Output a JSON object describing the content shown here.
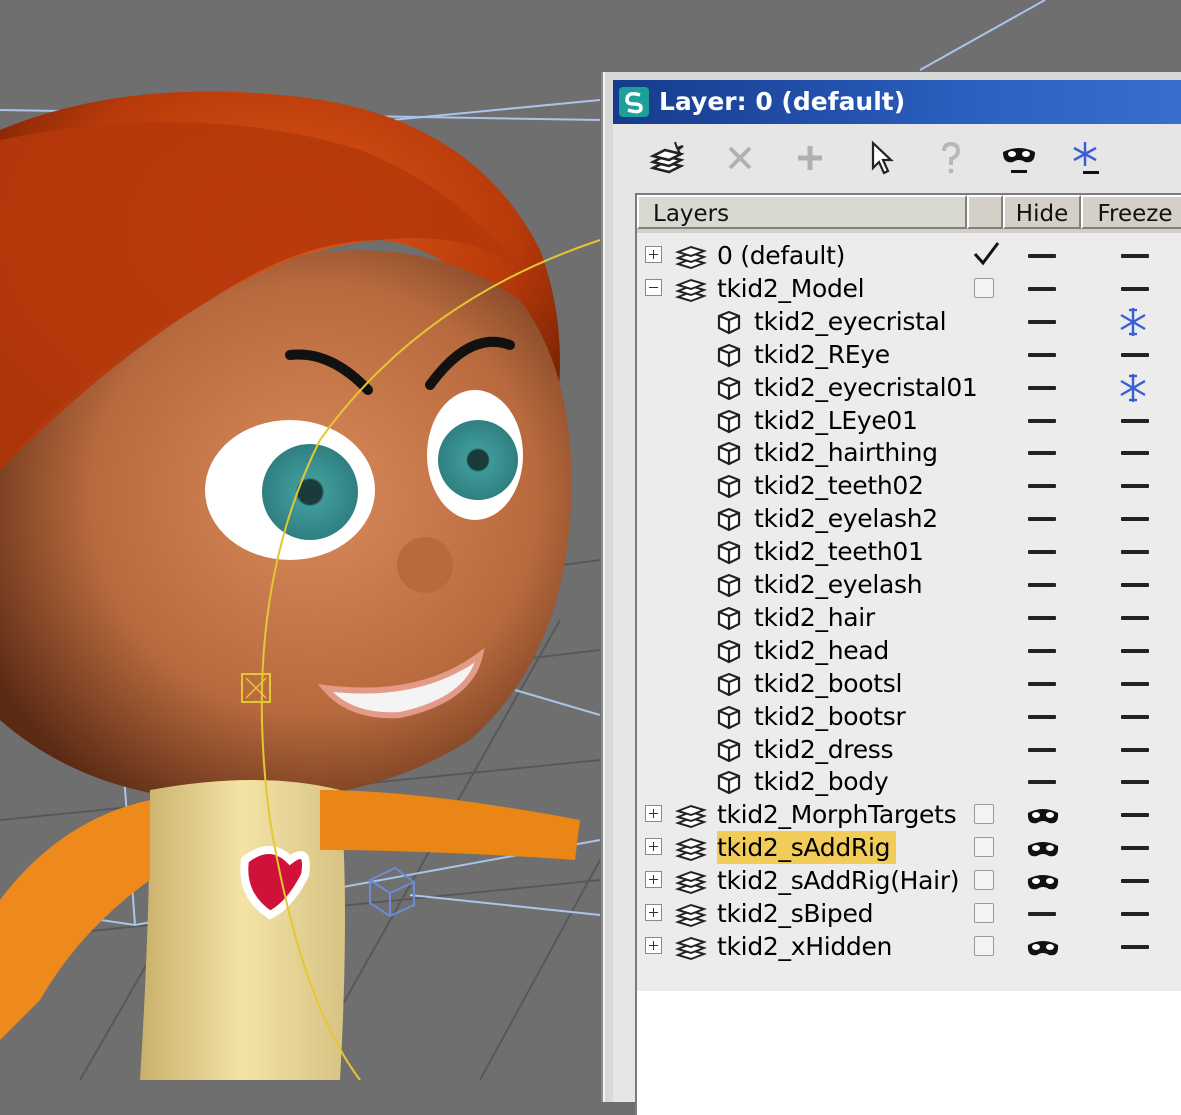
{
  "window": {
    "title": "Layer: 0 (default)"
  },
  "toolbar": {
    "buttons": [
      {
        "name": "create-layer",
        "icon": "new-layer-icon",
        "enabled": true
      },
      {
        "name": "delete-layer",
        "icon": "delete-x-icon",
        "enabled": false
      },
      {
        "name": "add-to-layer",
        "icon": "plus-icon",
        "enabled": false
      },
      {
        "name": "select-objects",
        "icon": "cursor-arrow-icon",
        "enabled": true
      },
      {
        "name": "highlight-selected",
        "icon": "question-icon",
        "enabled": false
      },
      {
        "name": "hide-unhide-all",
        "icon": "hide-mask-icon",
        "enabled": true
      },
      {
        "name": "freeze-unfreeze-all",
        "icon": "snowflake-icon",
        "enabled": true
      }
    ]
  },
  "columns": {
    "layers": "Layers",
    "current": "",
    "hide": "Hide",
    "freeze": "Freeze"
  },
  "rows": [
    {
      "name": "0 (default)",
      "type": "layer",
      "expander": "plus",
      "current": true,
      "hidden": false,
      "frozen": false
    },
    {
      "name": "tkid2_Model",
      "type": "layer",
      "expander": "minus",
      "current": false,
      "hidden": false,
      "frozen": false
    },
    {
      "name": "tkid2_eyecristal",
      "type": "object",
      "hidden": false,
      "frozen": true
    },
    {
      "name": "tkid2_REye",
      "type": "object",
      "hidden": false,
      "frozen": false
    },
    {
      "name": "tkid2_eyecristal01",
      "type": "object",
      "hidden": false,
      "frozen": true
    },
    {
      "name": "tkid2_LEye01",
      "type": "object",
      "hidden": false,
      "frozen": false
    },
    {
      "name": "tkid2_hairthing",
      "type": "object",
      "hidden": false,
      "frozen": false
    },
    {
      "name": "tkid2_teeth02",
      "type": "object",
      "hidden": false,
      "frozen": false
    },
    {
      "name": "tkid2_eyelash2",
      "type": "object",
      "hidden": false,
      "frozen": false
    },
    {
      "name": "tkid2_teeth01",
      "type": "object",
      "hidden": false,
      "frozen": false
    },
    {
      "name": "tkid2_eyelash",
      "type": "object",
      "hidden": false,
      "frozen": false
    },
    {
      "name": "tkid2_hair",
      "type": "object",
      "hidden": false,
      "frozen": false
    },
    {
      "name": "tkid2_head",
      "type": "object",
      "hidden": false,
      "frozen": false
    },
    {
      "name": "tkid2_bootsl",
      "type": "object",
      "hidden": false,
      "frozen": false
    },
    {
      "name": "tkid2_bootsr",
      "type": "object",
      "hidden": false,
      "frozen": false
    },
    {
      "name": "tkid2_dress",
      "type": "object",
      "hidden": false,
      "frozen": false
    },
    {
      "name": "tkid2_body",
      "type": "object",
      "hidden": false,
      "frozen": false
    },
    {
      "name": "tkid2_MorphTargets",
      "type": "layer",
      "expander": "plus",
      "current": false,
      "hidden": true,
      "frozen": false
    },
    {
      "name": "tkid2_sAddRig",
      "type": "layer",
      "expander": "plus",
      "current": false,
      "hidden": true,
      "frozen": false,
      "selected": true
    },
    {
      "name": "tkid2_sAddRig(Hair)",
      "type": "layer",
      "expander": "plus",
      "current": false,
      "hidden": true,
      "frozen": false
    },
    {
      "name": "tkid2_sBiped",
      "type": "layer",
      "expander": "plus",
      "current": false,
      "hidden": false,
      "frozen": false
    },
    {
      "name": "tkid2_xHidden",
      "type": "layer",
      "expander": "plus",
      "current": false,
      "hidden": true,
      "frozen": false
    }
  ],
  "colors": {
    "titlebar": "#2353b0",
    "selected_row": "#f2cc58",
    "viewport_bg": "#6f6f6f",
    "hair": "#c8400a",
    "skin": "#c9784a",
    "eye": "#4aa3a3"
  }
}
